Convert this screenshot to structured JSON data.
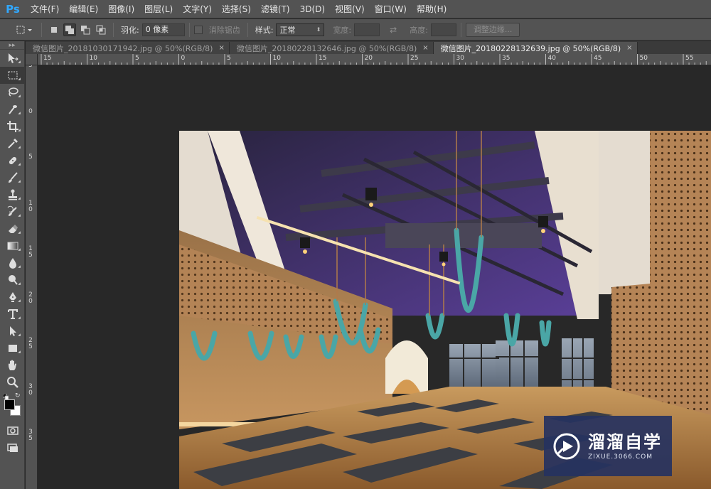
{
  "app": {
    "logo_text": "Ps"
  },
  "menu": [
    "文件(F)",
    "编辑(E)",
    "图像(I)",
    "图层(L)",
    "文字(Y)",
    "选择(S)",
    "滤镜(T)",
    "3D(D)",
    "视图(V)",
    "窗口(W)",
    "帮助(H)"
  ],
  "options": {
    "feather_label": "羽化:",
    "feather_value": "0 像素",
    "antialias_label": "消除锯齿",
    "style_label": "样式:",
    "style_value": "正常",
    "width_label": "宽度:",
    "height_label": "高度:",
    "refine_edge_button": "调整边缘..."
  },
  "tabs": [
    {
      "label": "微信图片_20181030171942.jpg @ 50%(RGB/8)",
      "active": false
    },
    {
      "label": "微信图片_20180228132646.jpg @ 50%(RGB/8)",
      "active": false
    },
    {
      "label": "微信图片_20180228132639.jpg @ 50%(RGB/8)",
      "active": true
    }
  ],
  "tab_close_glyph": "×",
  "ruler_h_labels": [
    "15",
    "10",
    "5",
    "0",
    "5",
    "10",
    "15",
    "20",
    "25",
    "30",
    "35",
    "40",
    "45",
    "50",
    "55"
  ],
  "ruler_v_labels": [
    "5",
    "0",
    "5",
    "1\n0",
    "1\n5",
    "2\n0",
    "2\n5",
    "3\n0",
    "3\n5"
  ],
  "tools": [
    "move-tool",
    "rectangular-marquee-tool",
    "lasso-tool",
    "quick-selection-tool",
    "crop-tool",
    "eyedropper-tool",
    "spot-healing-brush-tool",
    "brush-tool",
    "clone-stamp-tool",
    "history-brush-tool",
    "eraser-tool",
    "gradient-tool",
    "blur-tool",
    "dodge-tool",
    "pen-tool",
    "horizontal-type-tool",
    "path-selection-tool",
    "rectangle-tool",
    "hand-tool",
    "zoom-tool"
  ],
  "colors": {
    "foreground": "#000000",
    "background": "#ffffff",
    "accent_ps": "#31a8ff"
  },
  "watermark": {
    "title": "溜溜自学",
    "url": "ZIXUE.3066.COM"
  }
}
